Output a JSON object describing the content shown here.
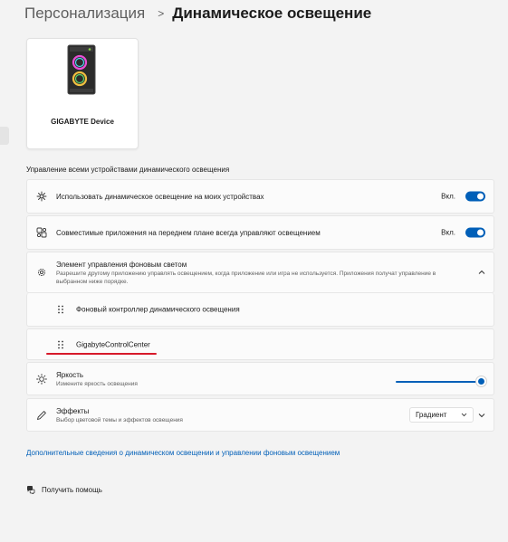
{
  "breadcrumb": {
    "parent": "Персонализация",
    "separator": ">",
    "current": "Динамическое освещение"
  },
  "device": {
    "name": "GIGABYTE Device",
    "icon": "pc-case-rgb-icon"
  },
  "section": {
    "title": "Управление всеми устройствами динамического освещения"
  },
  "settings": {
    "use_dynamic": {
      "label": "Использовать динамическое освещение на моих устройствах",
      "state_label": "Вкл.",
      "on": true,
      "icon": "sparkle-icon"
    },
    "foreground_apps": {
      "label": "Совместимые приложения на переднем плане всегда управляют освещением",
      "state_label": "Вкл.",
      "on": true,
      "icon": "apps-icon"
    },
    "background_control": {
      "label": "Элемент управления фоновым светом",
      "description": "Разрешите другому приложению управлять освещением, когда приложение или игра не используется. Приложения получат управление в выбранном ниже порядке.",
      "expanded": true,
      "icon": "gear-icon",
      "items": [
        "Фоновый контроллер динамического освещения",
        "GigabyteControlCenter"
      ]
    },
    "brightness": {
      "label": "Яркость",
      "description": "Измените яркость освещения",
      "value_fraction": 1.0,
      "icon": "sun-icon"
    },
    "effects": {
      "label": "Эффекты",
      "description": "Выбор цветовой темы и эффектов освещения",
      "selected": "Градиент",
      "icon": "pen-icon"
    }
  },
  "links": {
    "more_info": "Дополнительные сведения о динамическом освещении и управлении фоновым освещением"
  },
  "help": {
    "label": "Получить помощь",
    "icon": "help-chat-icon"
  },
  "colors": {
    "accent": "#005fb8",
    "annotation": "#d7192a",
    "background": "#f3f3f3",
    "card": "#fbfbfb"
  }
}
